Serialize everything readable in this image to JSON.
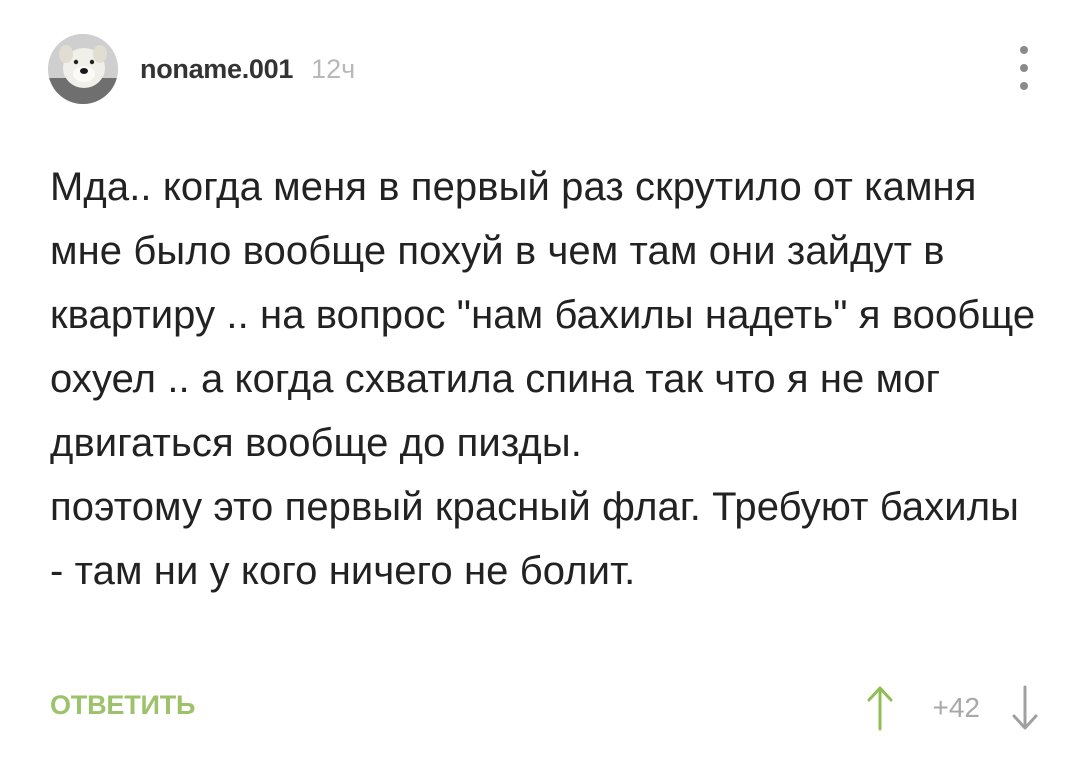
{
  "comment": {
    "author": {
      "username": "noname.001",
      "avatar_icon": "dog-avatar-icon"
    },
    "time_ago": "12ч",
    "body_paragraphs": [
      "Мда.. когда меня в первый раз скрутило от камня мне было вообще похуй в чем там они зайдут в квартиру .. на вопрос \"нам бахилы надеть\" я вообще охуел .. а когда схватила спина так что я не мог двигаться вообще до пизды.",
      "поэтому это первый красный флаг. Требуют бахилы - там ни у кого ничего не болит."
    ],
    "reply_label": "ОТВЕТИТЬ",
    "rating": "+42",
    "more_icon": "more-vertical-icon",
    "upvote_icon": "arrow-up-icon",
    "downvote_icon": "arrow-down-icon"
  },
  "colors": {
    "reply": "#9cc26a",
    "upvote": "#8fbe56",
    "downvote": "#a0a0a0",
    "muted": "#b8b8b8",
    "text": "#222222"
  }
}
